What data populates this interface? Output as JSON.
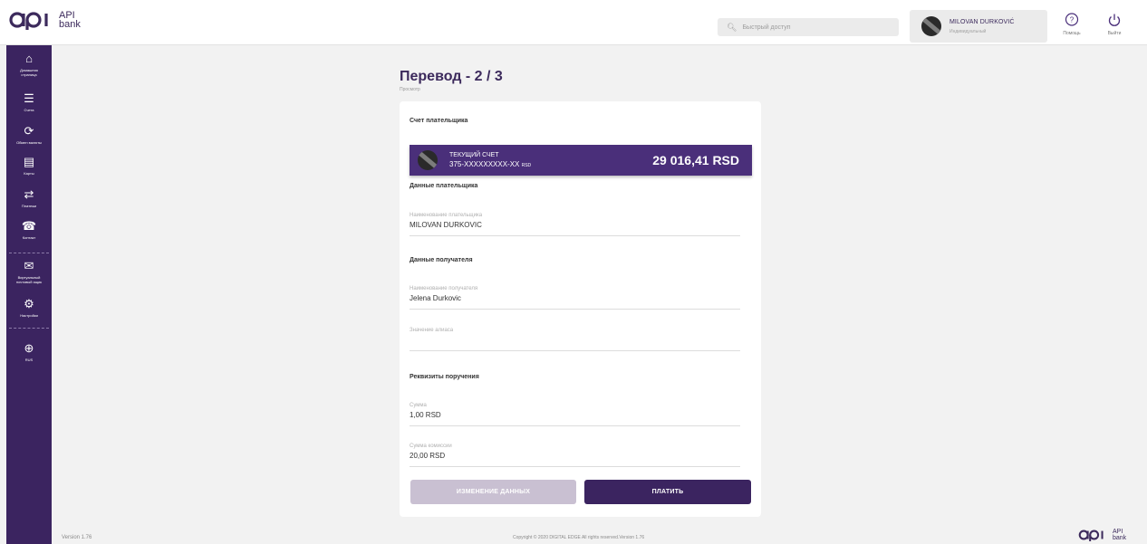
{
  "brand": {
    "logo_text": "API\nbank"
  },
  "header": {
    "search_placeholder": "Быстрый доступ",
    "user_name": "MILOVAN DURKOVIĆ",
    "user_role": "Индивидуальный",
    "help_label": "Помощь",
    "logout_label": "Выйти"
  },
  "sidebar": {
    "items": [
      {
        "icon": "home-icon",
        "label": "Домашняя\nстраница"
      },
      {
        "icon": "list-icon",
        "label": "Счета"
      },
      {
        "icon": "currency-exchange-icon",
        "label": "Обмен валюты"
      },
      {
        "icon": "cards-icon",
        "label": "Карты"
      },
      {
        "icon": "payments-icon",
        "label": "Платежи"
      },
      {
        "icon": "contact-icon",
        "label": "Контакт"
      },
      {
        "icon": "mailbox-icon",
        "label": "Виртуальный\nпочтовый ящик"
      },
      {
        "icon": "settings-icon",
        "label": "Настройки"
      },
      {
        "icon": "globe-icon",
        "label": "RUS"
      }
    ]
  },
  "page": {
    "title": "Перевод - 2 / 3",
    "subtitle": "Просмотр"
  },
  "payer_account": {
    "heading": "Счет плательщика",
    "type": "ТЕКУЩИЙ СЧЕТ",
    "number": "375-XXXXXXXXX-XX",
    "currency": "RSD",
    "balance": "29 016,41 RSD"
  },
  "payer_data": {
    "heading": "Данные плательщика",
    "name_label": "Наименование плательщика",
    "name_value": "MILOVAN DURKOVIC"
  },
  "recipient_data": {
    "heading": "Данные получателя",
    "name_label": "Наименование получателя",
    "name_value": "Jelena Durkovic",
    "alias_label": "Значение алиаса",
    "alias_value": ""
  },
  "order_details": {
    "heading": "Реквизиты поручения",
    "amount_label": "Сумма",
    "amount_value": "1,00 RSD",
    "fee_label": "Сумма комиссии",
    "fee_value": "20,00 RSD"
  },
  "actions": {
    "edit_label": "ИЗМЕНЕНИЕ ДАННЫХ",
    "pay_label": "ПЛАТИТЬ"
  },
  "footer": {
    "version": "Version 1.76",
    "copyright": "Copyright © 2020 DIGITAL EDGE All rights reserved.Version 1.76"
  },
  "colors": {
    "brand_purple": "#3b2460",
    "account_purple": "#4a2f7a",
    "button_disabled": "#c9c0d2",
    "background": "#f2f2f2"
  }
}
